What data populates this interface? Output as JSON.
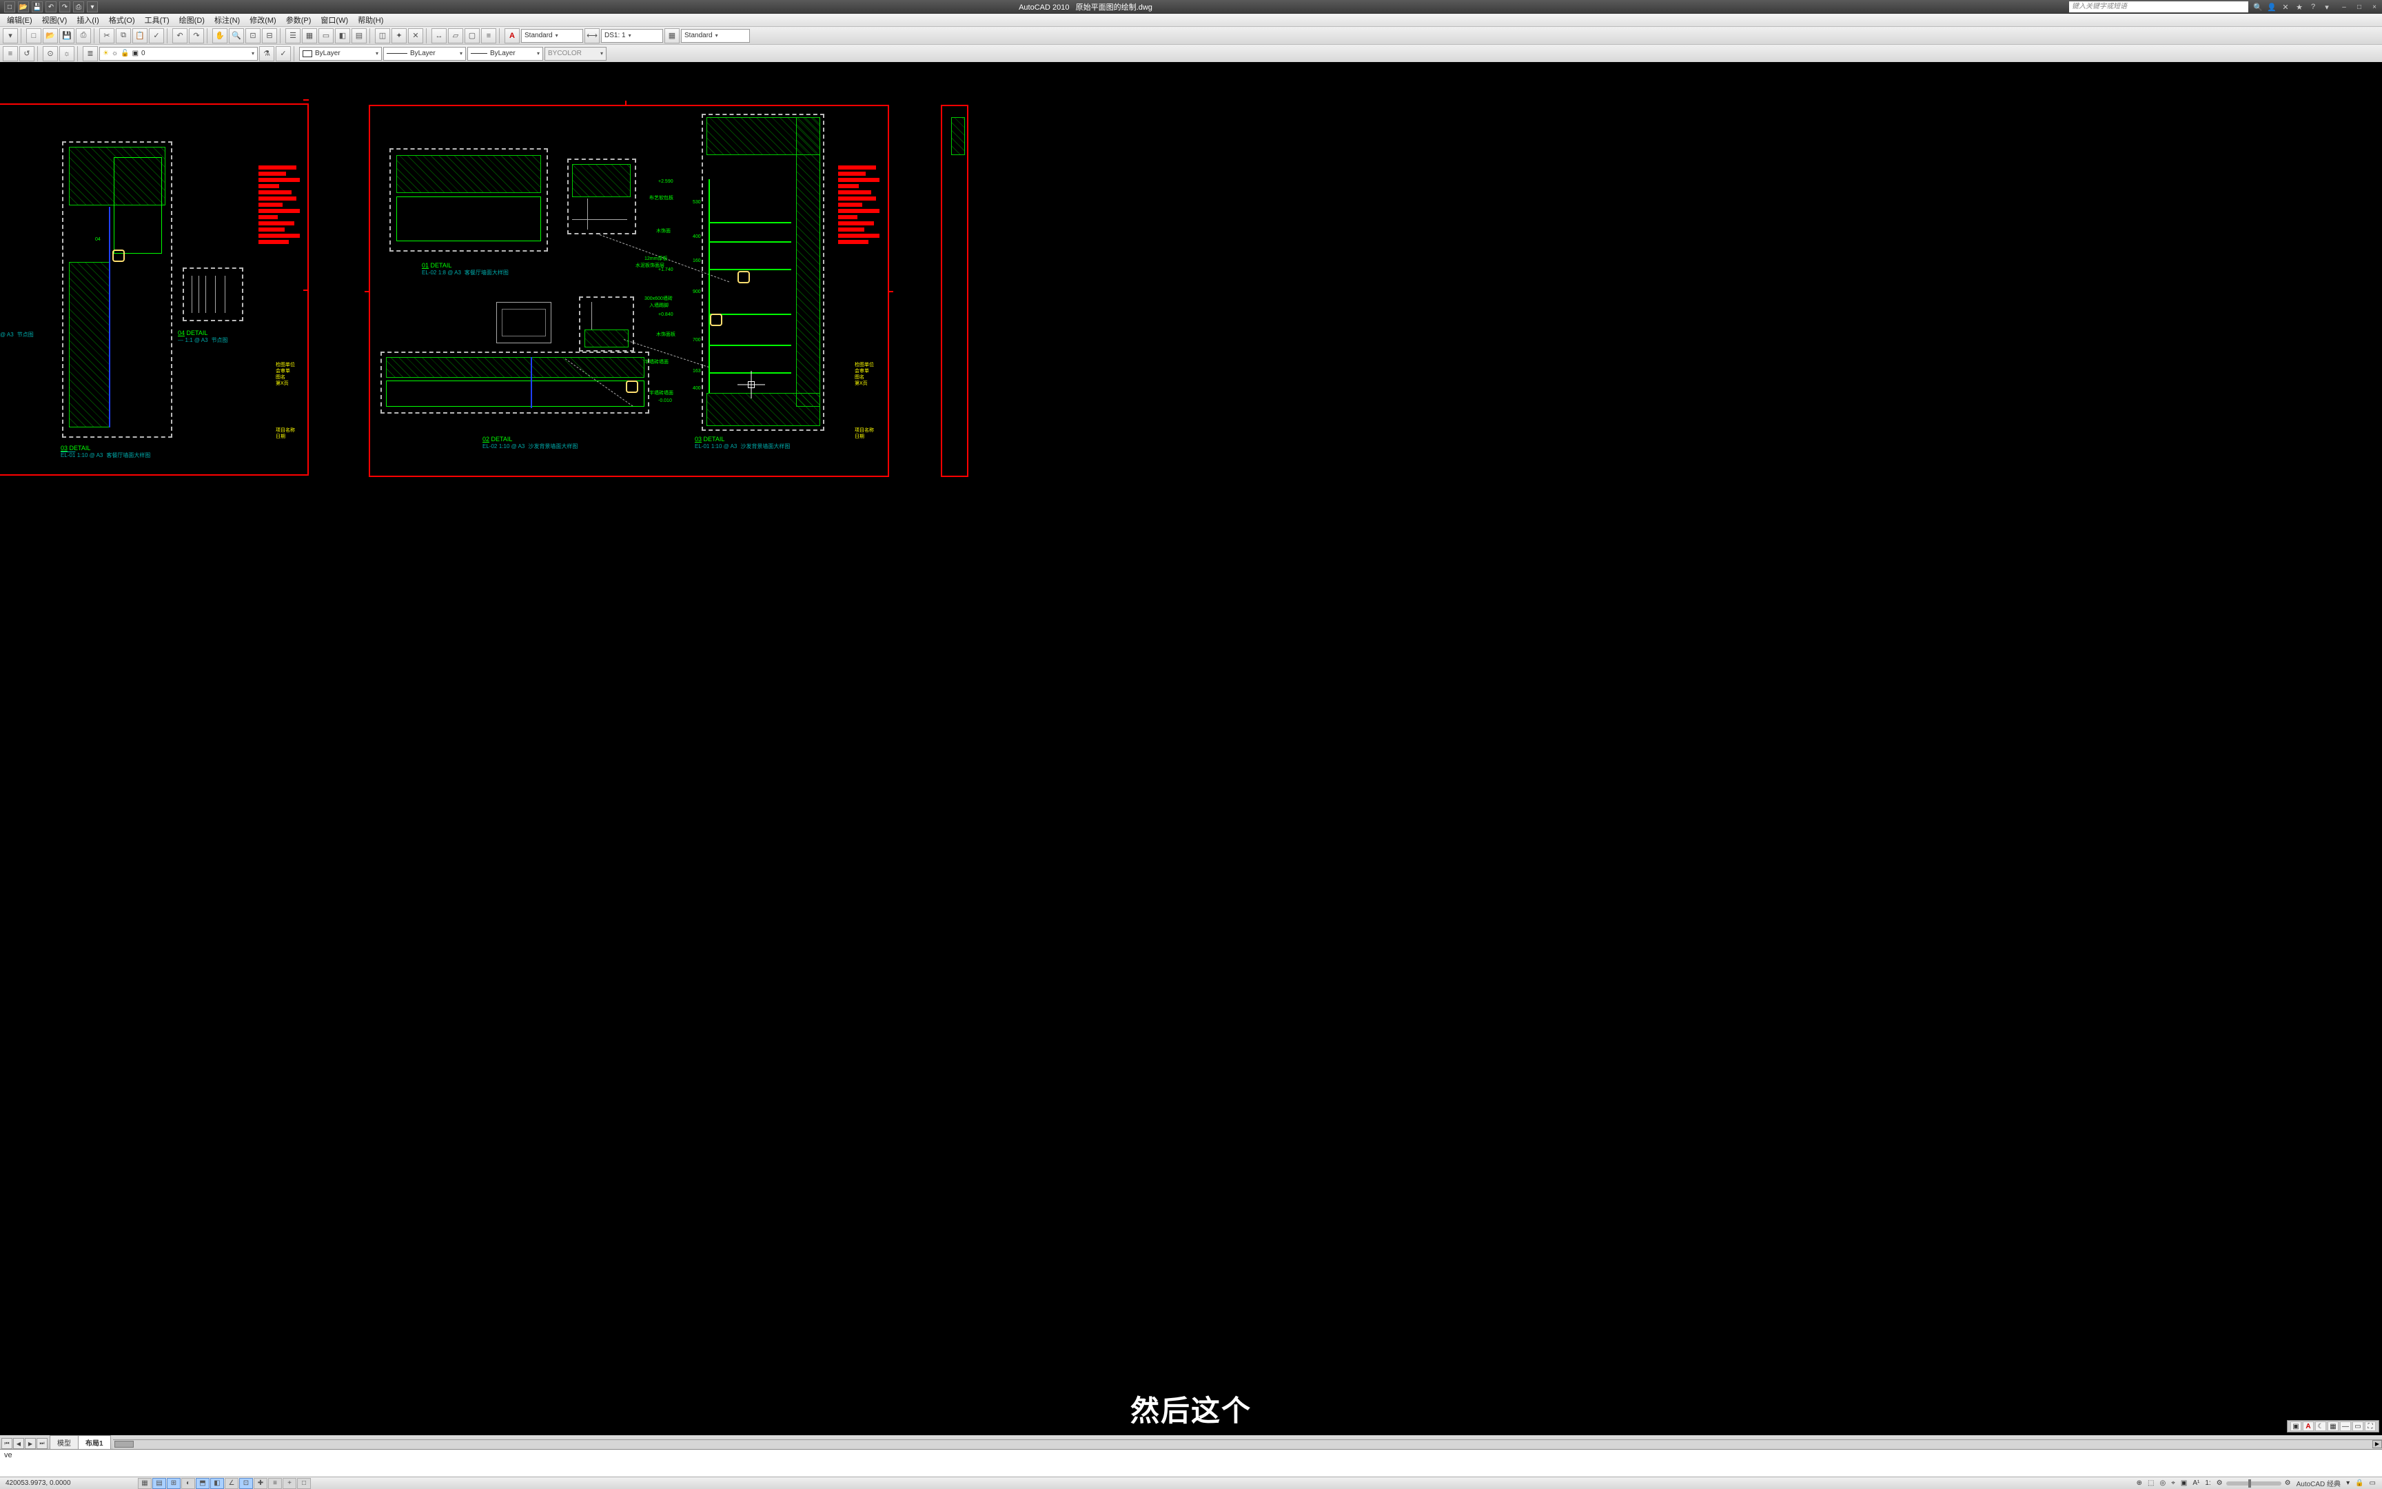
{
  "titlebar": {
    "app": "AutoCAD 2010",
    "doc": "原始平面图的绘制.dwg",
    "search_placeholder": "键入关键字或短语",
    "qat_icons": [
      "new-icon",
      "open-icon",
      "save-icon",
      "undo-icon",
      "redo-icon",
      "print-icon"
    ],
    "rtools": [
      "sign-in-icon",
      "exchange-icon",
      "link-icon",
      "favorite-icon",
      "help-icon"
    ],
    "winbtns": [
      "–",
      "□",
      "×"
    ]
  },
  "menubar": [
    "编辑(E)",
    "视图(V)",
    "插入(I)",
    "格式(O)",
    "工具(T)",
    "绘图(D)",
    "标注(N)",
    "修改(M)",
    "参数(P)",
    "窗口(W)",
    "帮助(H)"
  ],
  "toolbar1": {
    "left_btns": [
      "new",
      "open",
      "save",
      "plot",
      "cut",
      "copy",
      "paste",
      "match",
      "undo",
      "redo",
      "pan",
      "zoomw",
      "zoomp",
      "zoomr",
      "zoomall",
      "props",
      "dsv",
      "sheet",
      "tpal",
      "calc"
    ],
    "text_style": "Standard",
    "dim_style": "DS1: 1",
    "table_style": "Standard"
  },
  "toolbar2": {
    "extra_btns": [
      "layeriso",
      "layerprev",
      "layermgr"
    ],
    "layer": "0",
    "layer_right": [
      "filter",
      "state"
    ],
    "color": "ByLayer",
    "linetype": "ByLayer",
    "lineweight": "ByLayer",
    "plotstyle": "BYCOLOR"
  },
  "drawing": {
    "details": {
      "d03_left": {
        "num": "03",
        "title": "DETAIL",
        "meta": "1:10 @ A3",
        "desc": "客餐厅墙面大样图"
      },
      "d04": {
        "num": "04",
        "title": "DETAIL",
        "meta": "1:1 @ A3",
        "desc": "节点图"
      },
      "d_node_left": {
        "meta": "@ A3",
        "desc": "节点图"
      },
      "d01": {
        "num": "01",
        "title": "DETAIL",
        "meta": "1:8 @ A3",
        "desc": "客餐厅墙面大样图"
      },
      "d02": {
        "num": "02",
        "title": "DETAIL",
        "meta": "1:10 @ A3",
        "desc": "沙发背景墙面大样图"
      },
      "d03_right": {
        "num": "03",
        "title": "DETAIL",
        "meta": "1:10 @ A3",
        "desc": "沙发背景墙面大样图"
      }
    },
    "dims": {
      "a": "+2.590",
      "b": "+1.740",
      "c": "+0.840",
      "d": "-0.010",
      "n1": "12mm厚板",
      "n2": "水泥板饰面层",
      "n3": "木饰面",
      "n4": "300x600墙砖",
      "n5": "入墙踢脚",
      "n6": "木饰面板",
      "n7": "半墙砖墙面",
      "n8": "半墙砖墙面",
      "n9": "布艺软包板",
      "g1": "530",
      "g2": "400",
      "g3": "160",
      "g4": "900",
      "g5": "700",
      "g6": "163",
      "g7": "400"
    },
    "titleblock": {
      "a": "检图单位",
      "b": "会审单",
      "c": "图名",
      "d": "第X页"
    },
    "titleblock2": {
      "a": "项目名称",
      "b": "日期"
    }
  },
  "subtitle": "然后这个",
  "canvas_status_icons": [
    "model-icon",
    "a-icon",
    "moon-icon",
    "grid-icon",
    "dash-icon",
    "rect-icon",
    "maximize-icon"
  ],
  "tabs": {
    "nav": [
      "⏮",
      "◀",
      "▶",
      "⏭"
    ],
    "items": [
      {
        "label": "模型",
        "active": false
      },
      {
        "label": "布局1",
        "active": true
      }
    ]
  },
  "command": {
    "line1": "ve",
    "line2": ""
  },
  "statusbar": {
    "coords": "420053.9973, 0.0000",
    "toggles": [
      {
        "icon": "▦",
        "on": false
      },
      {
        "icon": "▤",
        "on": true
      },
      {
        "icon": "⊞",
        "on": true
      },
      {
        "icon": "◐",
        "on": false
      },
      {
        "icon": "⬒",
        "on": true
      },
      {
        "icon": "◧",
        "on": true
      },
      {
        "icon": "∠",
        "on": false
      },
      {
        "icon": "⊡",
        "on": true
      },
      {
        "icon": "✚",
        "on": false
      },
      {
        "icon": "≡",
        "on": false
      },
      {
        "icon": "+",
        "on": false
      },
      {
        "icon": "□",
        "on": false
      }
    ],
    "right": {
      "icons": [
        "⊕",
        "⬚",
        "◎",
        "⌖",
        "▣",
        "A1",
        "1:",
        "⚙"
      ],
      "workspace": "AutoCAD 经典"
    }
  }
}
